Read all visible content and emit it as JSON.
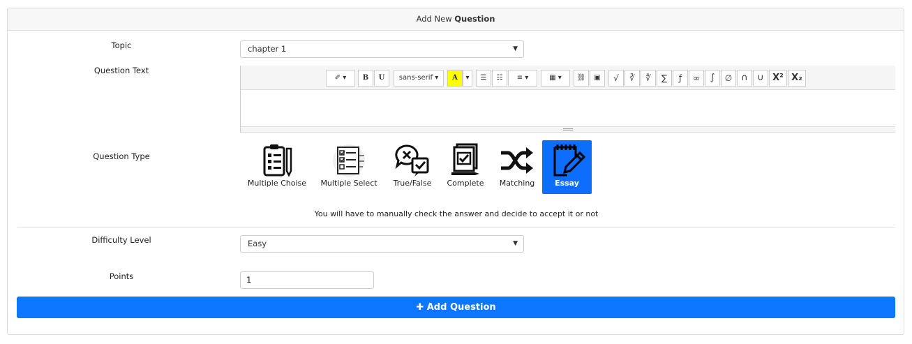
{
  "header": {
    "prefix": "Add New",
    "title": "Question"
  },
  "form": {
    "topic_label": "Topic",
    "topic_value": "chapter 1",
    "question_text_label": "Question Text",
    "question_type_label": "Question Type",
    "difficulty_label": "Difficulty Level",
    "difficulty_value": "Easy",
    "points_label": "Points",
    "points_value": "1"
  },
  "editor": {
    "toolbar": {
      "magic": "✐ ▾",
      "bold": "B",
      "underline": "U",
      "font": "sans-serif ▾",
      "color": "A",
      "color_caret": "▾",
      "ul": "☰",
      "ol": "☷",
      "align": "≡ ▾",
      "table": "▦ ▾",
      "link": "⛓",
      "image": "▣",
      "sqrt": "√",
      "cbrt": "∛",
      "fourthrt": "∜",
      "sum": "∑",
      "func": "ƒ",
      "infinity": "∞",
      "integral": "∫",
      "emptyset": "∅",
      "intersection": "∩",
      "union": "∪",
      "superscript": "X²",
      "subscript": "X₂"
    }
  },
  "question_types": [
    {
      "label": "Multiple Choise",
      "icon": "clipboard-list-icon"
    },
    {
      "label": "Multiple Select",
      "icon": "checklist-icon"
    },
    {
      "label": "True/False",
      "icon": "chat-bubbles-icon"
    },
    {
      "label": "Complete",
      "icon": "document-check-icon"
    },
    {
      "label": "Matching",
      "icon": "shuffle-icon"
    },
    {
      "label": "Essay",
      "icon": "notepad-pencil-icon",
      "active": true
    }
  ],
  "hint": "You will have to manually check the answer and decide to accept it or not",
  "submit": {
    "label": "Add Question",
    "icon": "plus-icon"
  },
  "colors": {
    "primary": "#0d78ff",
    "active_type": "#0d6efd"
  }
}
